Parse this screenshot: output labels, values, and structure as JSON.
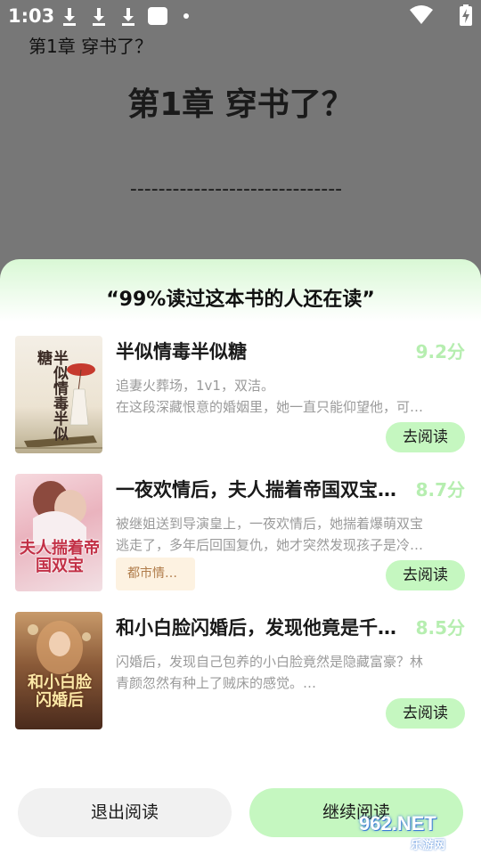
{
  "status_bar": {
    "time": "1:03"
  },
  "reader": {
    "header": "第1章 穿书了？",
    "chapter_title": "第1章 穿书了？",
    "divider": "------------------------------"
  },
  "sheet": {
    "title": "“99%读过这本书的人还在读”",
    "books": [
      {
        "title": "半似情毒半似糖",
        "score": "9.2分",
        "desc_line1": "追妻火葬场，1v1，双洁。",
        "desc_line2": "在这段深藏恨意的婚姻里，她一直只能仰望他，可…",
        "action": "去阅读",
        "cover_text": "半似情毒半似糖"
      },
      {
        "title": "一夜欢情后，夫人揣着帝国双宝…",
        "score": "8.7分",
        "desc_line1": "被继姐送到导演皇上，一夜欢情后，她揣着爆萌双宝",
        "desc_line2": "逃走了，多年后回国复仇，她才突然发现孩子是冷…",
        "tag": "都市情…",
        "action": "去阅读",
        "cover_text": "夫人揣着帝国双宝"
      },
      {
        "title": "和小白脸闪婚后，发现他竟是千…",
        "score": "8.5分",
        "desc_line1": "闪婚后，发现自己包养的小白脸竟然是隐藏富豪？林",
        "desc_line2": "青颜忽然有种上了贼床的感觉。…",
        "action": "去阅读",
        "cover_text": "和小白脸闪婚后"
      }
    ],
    "exit_label": "退出阅读",
    "continue_label": "继续阅读"
  },
  "watermark": {
    "main": "962.NET",
    "sub": "乐游网"
  },
  "colors": {
    "accent": "#c5f7c0",
    "score": "#b6eeb0",
    "sheet_top": "#d9f8d5"
  }
}
